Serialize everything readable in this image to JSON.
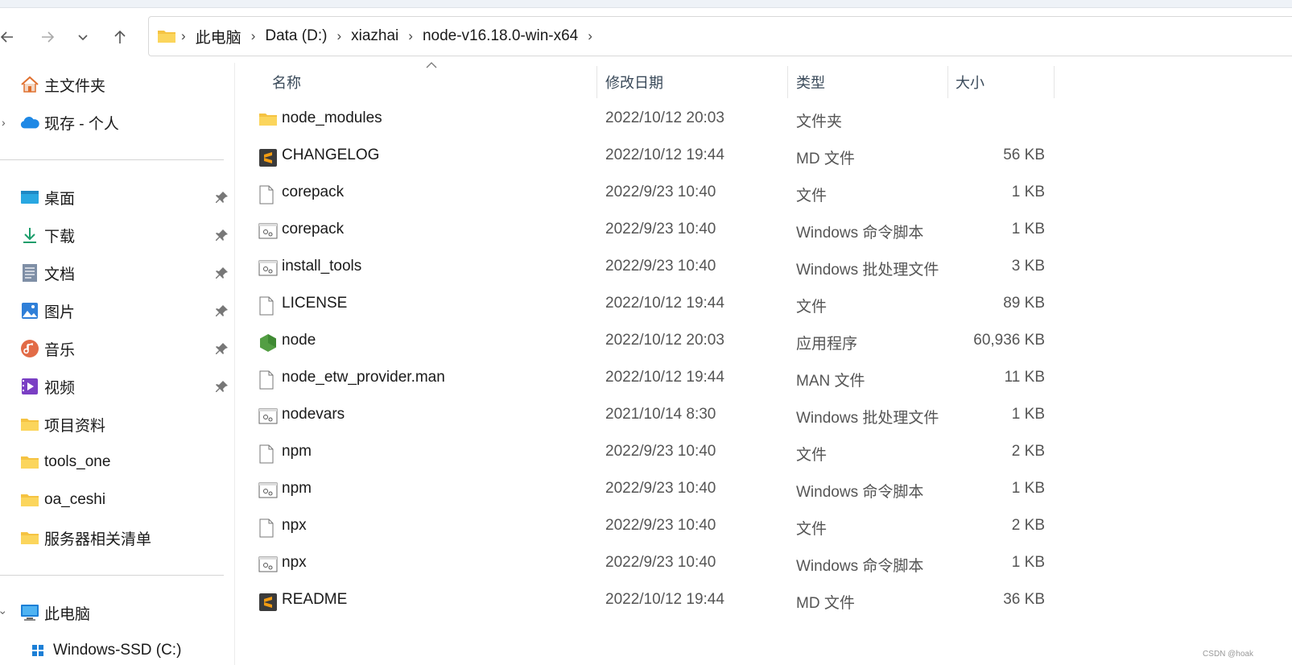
{
  "nav": {
    "back_icon": "arrow-left-icon",
    "forward_icon": "arrow-right-icon",
    "recent_icon": "chevron-down-icon",
    "up_icon": "arrow-up-icon"
  },
  "address": {
    "crumbs": [
      "此电脑",
      "Data (D:)",
      "xiazhai",
      "node-v16.18.0-win-x64"
    ],
    "separator": "›"
  },
  "sidebar": {
    "home": "主文件夹",
    "cloud": "现存 - 个人",
    "pinned": [
      {
        "label": "桌面",
        "icon": "desktop-icon"
      },
      {
        "label": "下载",
        "icon": "download-icon"
      },
      {
        "label": "文档",
        "icon": "document-icon"
      },
      {
        "label": "图片",
        "icon": "pictures-icon"
      },
      {
        "label": "音乐",
        "icon": "music-icon"
      },
      {
        "label": "视频",
        "icon": "video-icon"
      }
    ],
    "folders": [
      "项目资料",
      "tools_one",
      "oa_ceshi",
      "服务器相关清单"
    ],
    "this_pc": "此电脑",
    "drive_partial": "Windows-SSD (C:)"
  },
  "columns": {
    "name": "名称",
    "date": "修改日期",
    "type": "类型",
    "size": "大小"
  },
  "files": [
    {
      "name": "node_modules",
      "date": "2022/10/12 20:03",
      "type": "文件夹",
      "size": "",
      "icon": "folder-icon"
    },
    {
      "name": "CHANGELOG",
      "date": "2022/10/12 19:44",
      "type": "MD 文件",
      "size": "56 KB",
      "icon": "sublime-icon"
    },
    {
      "name": "corepack",
      "date": "2022/9/23 10:40",
      "type": "文件",
      "size": "1 KB",
      "icon": "file-icon"
    },
    {
      "name": "corepack",
      "date": "2022/9/23 10:40",
      "type": "Windows 命令脚本",
      "size": "1 KB",
      "icon": "script-icon"
    },
    {
      "name": "install_tools",
      "date": "2022/9/23 10:40",
      "type": "Windows 批处理文件",
      "size": "3 KB",
      "icon": "script-icon"
    },
    {
      "name": "LICENSE",
      "date": "2022/10/12 19:44",
      "type": "文件",
      "size": "89 KB",
      "icon": "file-icon"
    },
    {
      "name": "node",
      "date": "2022/10/12 20:03",
      "type": "应用程序",
      "size": "60,936 KB",
      "icon": "nodejs-icon"
    },
    {
      "name": "node_etw_provider.man",
      "date": "2022/10/12 19:44",
      "type": "MAN 文件",
      "size": "11 KB",
      "icon": "file-icon"
    },
    {
      "name": "nodevars",
      "date": "2021/10/14 8:30",
      "type": "Windows 批处理文件",
      "size": "1 KB",
      "icon": "script-icon"
    },
    {
      "name": "npm",
      "date": "2022/9/23 10:40",
      "type": "文件",
      "size": "2 KB",
      "icon": "file-icon"
    },
    {
      "name": "npm",
      "date": "2022/9/23 10:40",
      "type": "Windows 命令脚本",
      "size": "1 KB",
      "icon": "script-icon"
    },
    {
      "name": "npx",
      "date": "2022/9/23 10:40",
      "type": "文件",
      "size": "2 KB",
      "icon": "file-icon"
    },
    {
      "name": "npx",
      "date": "2022/9/23 10:40",
      "type": "Windows 命令脚本",
      "size": "1 KB",
      "icon": "script-icon"
    },
    {
      "name": "README",
      "date": "2022/10/12 19:44",
      "type": "MD 文件",
      "size": "36 KB",
      "icon": "sublime-icon"
    }
  ],
  "watermark": "CSDN @hoak",
  "colors": {
    "folder": "#f5c342",
    "accent": "#0067c0",
    "node_green": "#539e43",
    "sublime_orange": "#f39c12"
  }
}
